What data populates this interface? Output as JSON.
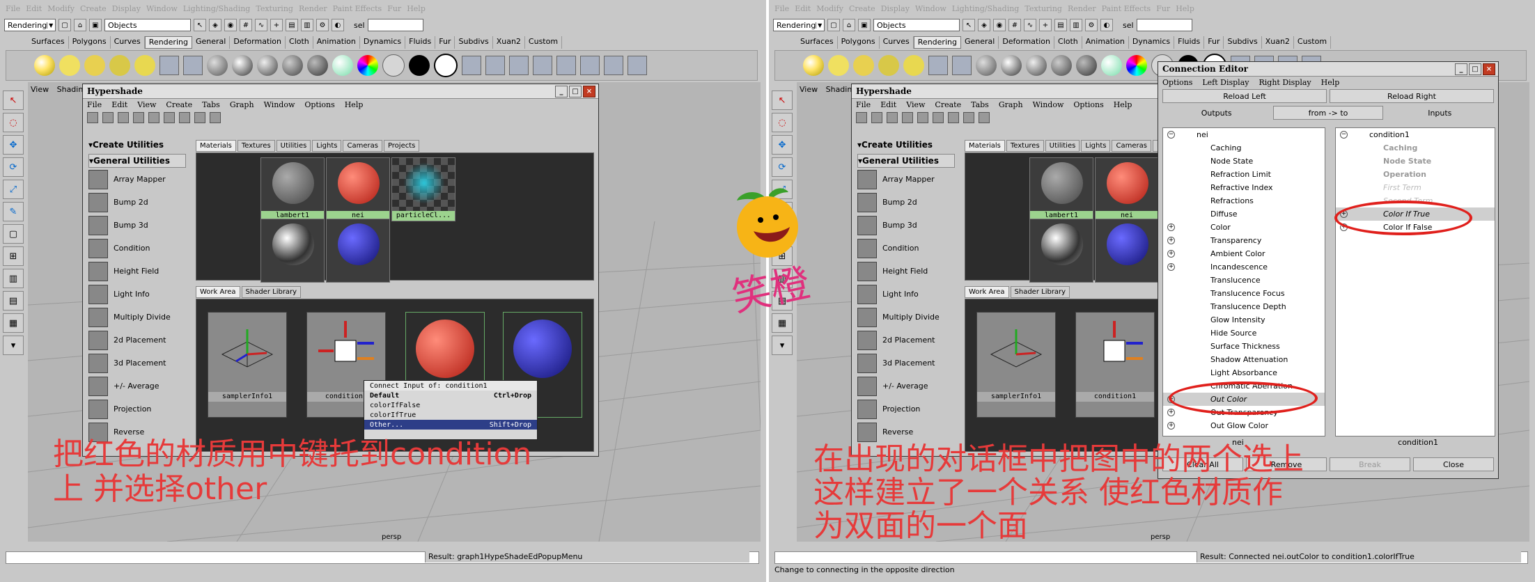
{
  "menu": [
    "File",
    "Edit",
    "Modify",
    "Create",
    "Display",
    "Window",
    "Lighting/Shading",
    "Texturing",
    "Render",
    "Paint Effects",
    "Fur",
    "Help"
  ],
  "status": {
    "mode": "Rendering",
    "object_field": "Objects",
    "sel": "sel"
  },
  "shelf_tabs": [
    "Surfaces",
    "Polygons",
    "Curves",
    "Rendering",
    "General",
    "Deformation",
    "Cloth",
    "Animation",
    "Dynamics",
    "Fluids",
    "Fur",
    "Subdivs",
    "Xuan2",
    "Custom"
  ],
  "viewport": {
    "menu": [
      "View",
      "Shading"
    ],
    "camera": "persp"
  },
  "hypershade": {
    "title": "Hypershade",
    "menu": [
      "File",
      "Edit",
      "View",
      "Create",
      "Tabs",
      "Graph",
      "Window",
      "Options",
      "Help"
    ],
    "create_header": "Create Utilities",
    "utilities_header": "General Utilities",
    "utilities": [
      "Array Mapper",
      "Bump 2d",
      "Bump 3d",
      "Condition",
      "Height Field",
      "Light Info",
      "Multiply Divide",
      "2d Placement",
      "3d Placement",
      "+/- Average",
      "Projection",
      "Reverse"
    ],
    "tabs": [
      "Materials",
      "Textures",
      "Utilities",
      "Lights",
      "Cameras",
      "Projects"
    ],
    "swatches": [
      "lambert1",
      "nei",
      "particleCl..."
    ],
    "work_tabs": [
      "Work Area",
      "Shader Library"
    ],
    "nodes": [
      "samplerInfo1",
      "condition1"
    ]
  },
  "context_menu": {
    "title": "Connect Input of: condition1",
    "items": [
      {
        "label": "Default",
        "shortcut": "Ctrl+Drop"
      },
      {
        "label": "colorIfFalse",
        "shortcut": ""
      },
      {
        "label": "colorIfTrue",
        "shortcut": ""
      },
      {
        "label": "Other...",
        "shortcut": "Shift+Drop"
      }
    ]
  },
  "result_left": "Result: graph1HypeShadeEdPopupMenu",
  "result_right": "Result: Connected nei.outColor to condition1.colorIfTrue",
  "help_right": "Change to connecting in the opposite direction",
  "annotation_left": "把红色的材质用中键托到condition\n上  并选择other",
  "annotation_right": "在出现的对话框中把图中的两个选上\n这样建立了一个关系  使红色材质作\n为双面的一个面",
  "mascot_text": "笑橙",
  "connection_editor": {
    "title": "Connection Editor",
    "menu": [
      "Options",
      "Left Display",
      "Right Display",
      "Help"
    ],
    "reload_left": "Reload Left",
    "reload_right": "Reload Right",
    "outputs": "Outputs",
    "from_to": "from -> to",
    "inputs": "Inputs",
    "left_node": "nei",
    "right_node": "condition1",
    "left_attrs": [
      "Caching",
      "Node State",
      "Refraction Limit",
      "Refractive Index",
      "Refractions",
      "Diffuse",
      "Color",
      "Transparency",
      "Ambient Color",
      "Incandescence",
      "Translucence",
      "Translucence Focus",
      "Translucence Depth",
      "Glow Intensity",
      "Hide Source",
      "Surface Thickness",
      "Shadow Attenuation",
      "Light Absorbance",
      "Chromatic Aberration",
      "Out Color",
      "Out Transparency",
      "Out Glow Color"
    ],
    "right_attrs": [
      "Caching",
      "Node State",
      "Operation",
      "First Term",
      "Second Term",
      "Color If True",
      "Color If False"
    ],
    "bottom_left": "nei",
    "bottom_right": "condition1",
    "clear_all": "Clear All",
    "remove": "Remove",
    "break": "Break",
    "close": "Close"
  }
}
